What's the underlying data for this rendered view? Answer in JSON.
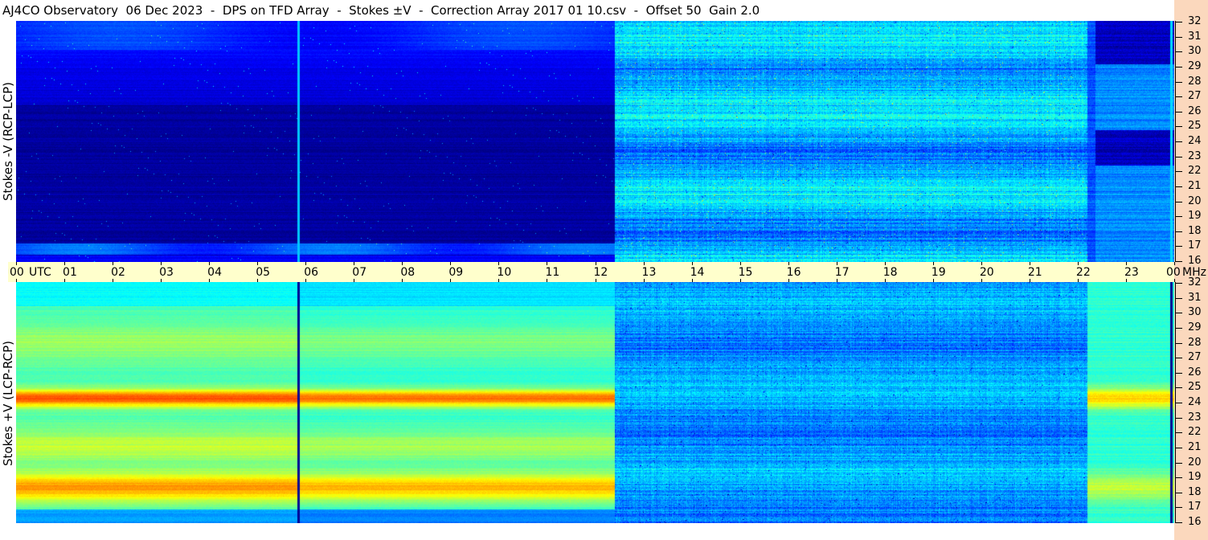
{
  "title": "AJ4CO Observatory  06 Dec 2023  -  DPS on TFD Array  -  Stokes ±V  -  Correction Array 2017 01 10.csv  -  Offset 50  Gain 2.0",
  "chart_data": [
    {
      "type": "heatmap",
      "ylabel": "Stokes -V (RCP-LCP)",
      "y_unit": "MHz",
      "ylim": [
        16,
        32
      ],
      "y_ticks": [
        "32",
        "31",
        "30",
        "29",
        "28",
        "27",
        "26",
        "25",
        "24",
        "23",
        "22",
        "21",
        "20",
        "19",
        "18",
        "17",
        "16"
      ],
      "colormap": "jet",
      "regions": [
        {
          "t_start_utc": 0.0,
          "t_end_utc": 12.4,
          "level": "very low"
        },
        {
          "t_start_utc": 12.4,
          "t_end_utc": 22.2,
          "level": "medium"
        },
        {
          "t_start_utc": 22.2,
          "t_end_utc": 24.0,
          "level": "low"
        }
      ]
    },
    {
      "type": "heatmap",
      "ylabel": "Stokes +V (LCP-RCP)",
      "y_unit": "MHz",
      "ylim": [
        16,
        32
      ],
      "y_ticks": [
        "32",
        "31",
        "30",
        "29",
        "28",
        "27",
        "26",
        "25",
        "24",
        "23",
        "22",
        "21",
        "20",
        "19",
        "18",
        "17",
        "16"
      ],
      "colormap": "jet",
      "regions": [
        {
          "t_start_utc": 0.0,
          "t_end_utc": 12.4,
          "level": "high"
        },
        {
          "t_start_utc": 12.4,
          "t_end_utc": 22.2,
          "level": "medium-low"
        },
        {
          "t_start_utc": 22.2,
          "t_end_utc": 24.0,
          "level": "medium-high"
        }
      ]
    }
  ],
  "time_axis": {
    "ticks": [
      "00",
      "01",
      "02",
      "03",
      "04",
      "05",
      "06",
      "07",
      "08",
      "09",
      "10",
      "11",
      "12",
      "13",
      "14",
      "15",
      "16",
      "17",
      "18",
      "19",
      "20",
      "21",
      "22",
      "23",
      "00"
    ],
    "utc_label": "UTC",
    "unit_label": "MHz"
  },
  "colors": {
    "time_bar": "#ffffcc",
    "right_strip": "#fbd8bd"
  }
}
